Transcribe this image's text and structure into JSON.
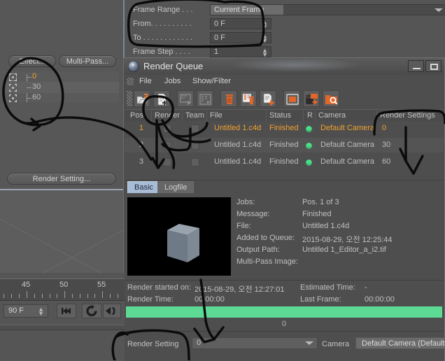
{
  "app": {
    "background_color": "#555555",
    "accent_orange": "#f0a030",
    "status_green": "#4de08a",
    "progress_green": "#5ddb95"
  },
  "left_panel": {
    "effect_button": "Effect...",
    "multipass_button": "Multi-Pass...",
    "render_setting_button": "Render Setting...",
    "takes": [
      {
        "label": "0",
        "selected": true,
        "icon": "render-target-icon"
      },
      {
        "label": "30",
        "selected": false,
        "icon": "render-target-icon"
      },
      {
        "label": "60",
        "selected": false,
        "icon": "render-target-icon"
      }
    ]
  },
  "top_fields": {
    "rows": [
      {
        "label": "Frame Range . . .",
        "value": "Current Frame",
        "type": "dropdown"
      },
      {
        "label": "From. . . . . . . . . .",
        "value": "0 F",
        "type": "spinner"
      },
      {
        "label": "To . . . . . . . . . . . .",
        "value": "0 F",
        "type": "spinner"
      },
      {
        "label": "Frame Step . . . .",
        "value": "1",
        "type": "spinner"
      }
    ]
  },
  "render_queue": {
    "title": "Render Queue",
    "window_buttons": [
      {
        "name": "minimize-button",
        "glyph": "minimize-icon"
      },
      {
        "name": "maximize-button",
        "glyph": "maximize-icon"
      }
    ],
    "menu": [
      "File",
      "Jobs",
      "Show/Filter"
    ],
    "toolbar": [
      {
        "name": "open-job-icon",
        "tip": "Open Job"
      },
      {
        "name": "add-job-icon",
        "tip": "Add Job"
      },
      {
        "name": "render-selected-icon",
        "tip": "Render Selected"
      },
      {
        "name": "render-all-icon",
        "tip": "Render All"
      },
      {
        "name": "delete-job-icon",
        "tip": "Delete Job"
      },
      {
        "name": "clear-list-icon",
        "tip": "Clear List"
      },
      {
        "name": "move-job-icon",
        "tip": "Move Job"
      },
      {
        "name": "picture-viewer-icon",
        "tip": "Picture Viewer"
      },
      {
        "name": "batch-render-icon",
        "tip": "Batch Render"
      },
      {
        "name": "inspect-job-icon",
        "tip": "Inspect Job"
      }
    ],
    "table": {
      "headers": [
        "Pos.",
        "Render",
        "Team",
        "File",
        "Status",
        "R",
        "Camera",
        "Render Settings"
      ],
      "rows": [
        {
          "pos": "1",
          "render": false,
          "team": false,
          "file": "Untitled 1.c4d",
          "status": "Finished",
          "r": "green",
          "camera": "Default Camera",
          "render_settings": "0",
          "selected": true
        },
        {
          "pos": "2",
          "render": false,
          "team": false,
          "file": "Untitled 1.c4d",
          "status": "Finished",
          "r": "green",
          "camera": "Default Camera",
          "render_settings": "30",
          "selected": false
        },
        {
          "pos": "3",
          "render": false,
          "team": false,
          "file": "Untitled 1.c4d",
          "status": "Finished",
          "r": "green",
          "camera": "Default Camera",
          "render_settings": "60",
          "selected": false
        }
      ]
    },
    "tabs": [
      {
        "label": "Basic",
        "active": true
      },
      {
        "label": "Logfile",
        "active": false
      }
    ],
    "details": [
      {
        "label": "Jobs:",
        "value": "Pos. 1 of 3"
      },
      {
        "label": "Message:",
        "value": "Finished"
      },
      {
        "label": "File:",
        "value": "Untitled 1.c4d"
      },
      {
        "label": "Added to Queue:",
        "value": "2015-08-29, 오전 12:25:44"
      },
      {
        "label": "Output Path:",
        "value": "Untitled 1_Editor_a_i2.tif"
      },
      {
        "label": "Multi-Pass Image:",
        "value": ""
      }
    ],
    "stats": {
      "render_started_label": "Render started on:",
      "render_started_value": "2015-08-29, 오전 12:27:01",
      "render_time_label": "Render Time:",
      "render_time_value": "00:00:00",
      "estimated_time_label": "Estimated Time:",
      "estimated_time_value": "-",
      "last_frame_label": "Last Frame:",
      "last_frame_value": "00:00:00"
    },
    "progress": {
      "value": 100,
      "caption": "0"
    },
    "bottom": {
      "render_setting_label": "Render Setting",
      "render_setting_value": "0",
      "camera_label": "Camera",
      "camera_value": "Default Camera (Default)"
    }
  },
  "timeline": {
    "ruler_labels": [
      "45",
      "50",
      "55"
    ],
    "frame_field_value": "90 F",
    "buttons": [
      {
        "name": "go-to-start-button",
        "glyph": "skip-back-icon"
      },
      {
        "name": "loop-button",
        "glyph": "loop-icon"
      },
      {
        "name": "play-reverse-button",
        "glyph": "play-reverse-icon"
      }
    ]
  },
  "annotations": {
    "description": "Hand-drawn black marker circles and arrows",
    "shapes": [
      "circle-around-frame-range-fields",
      "circle-around-take-list",
      "arrow-from-take-list-to-queue-table",
      "circle-around-add-job-icon",
      "arrow-from-add-job-to-render-checkboxes",
      "bracket-around-render-settings-column-header",
      "arrow-from-render-settings-header-down",
      "arrow-from-thumbnail-to-render-setting-dropdown",
      "circle-around-render-setting-dropdown-label"
    ]
  }
}
